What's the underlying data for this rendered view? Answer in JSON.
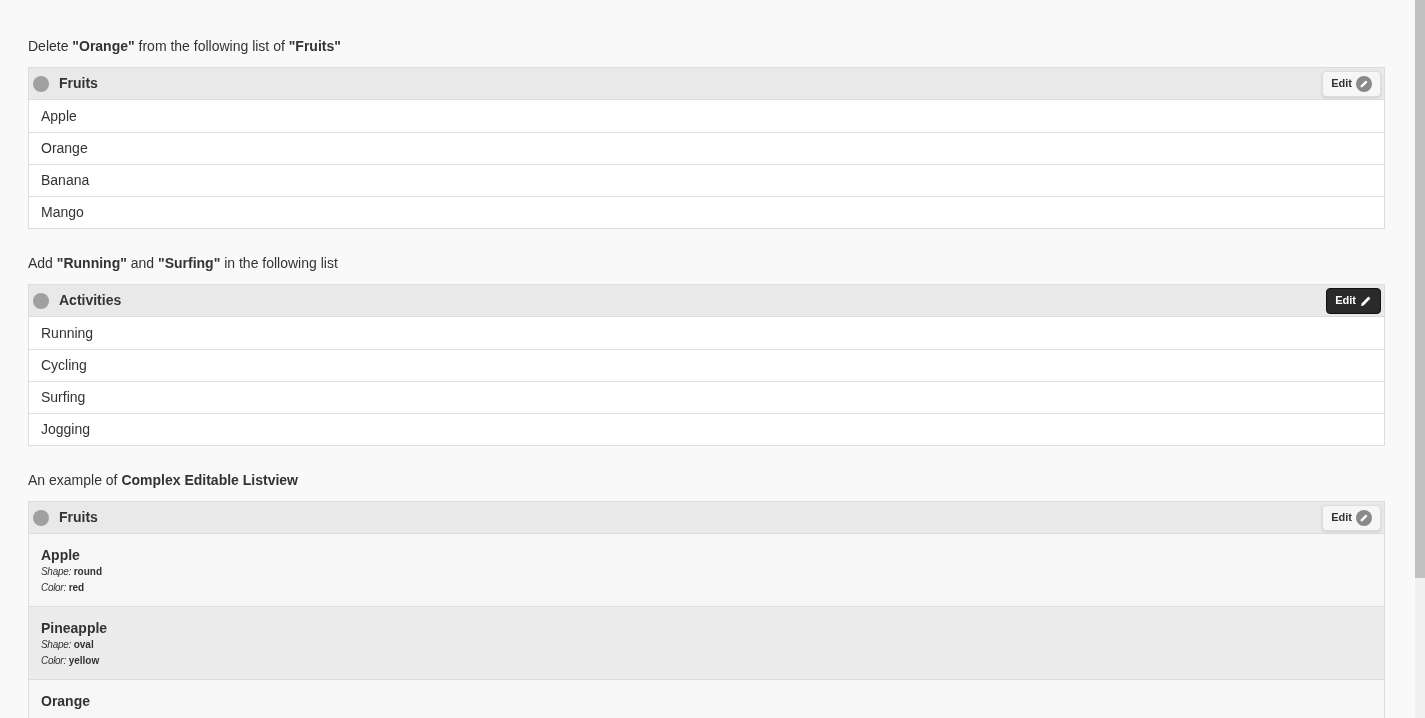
{
  "sections": [
    {
      "instruction": "Delete **\"Orange\"** from the following list of **\"Fruits\"**",
      "list": {
        "title": "Fruits",
        "edit": {
          "label": "Edit",
          "active": false
        },
        "kind": "simple",
        "items": [
          {
            "label": "Apple"
          },
          {
            "label": "Orange"
          },
          {
            "label": "Banana"
          },
          {
            "label": "Mango"
          }
        ]
      }
    },
    {
      "instruction": "Add **\"Running\"** and **\"Surfing\"** in the following list",
      "list": {
        "title": "Activities",
        "edit": {
          "label": "Edit",
          "active": true
        },
        "kind": "simple",
        "items": [
          {
            "label": "Running"
          },
          {
            "label": "Cycling"
          },
          {
            "label": "Surfing"
          },
          {
            "label": "Jogging"
          }
        ]
      }
    },
    {
      "instruction": "An example of **Complex Editable Listview**",
      "list": {
        "title": "Fruits",
        "edit": {
          "label": "Edit",
          "active": false
        },
        "kind": "complex",
        "items": [
          {
            "label": "Apple",
            "fields": [
              {
                "name": "Shape:",
                "value": "round"
              },
              {
                "name": "Color:",
                "value": "red"
              }
            ]
          },
          {
            "label": "Pineapple",
            "fields": [
              {
                "name": "Shape:",
                "value": "oval"
              },
              {
                "name": "Color:",
                "value": "yellow"
              }
            ]
          },
          {
            "label": "Orange"
          }
        ]
      }
    }
  ]
}
